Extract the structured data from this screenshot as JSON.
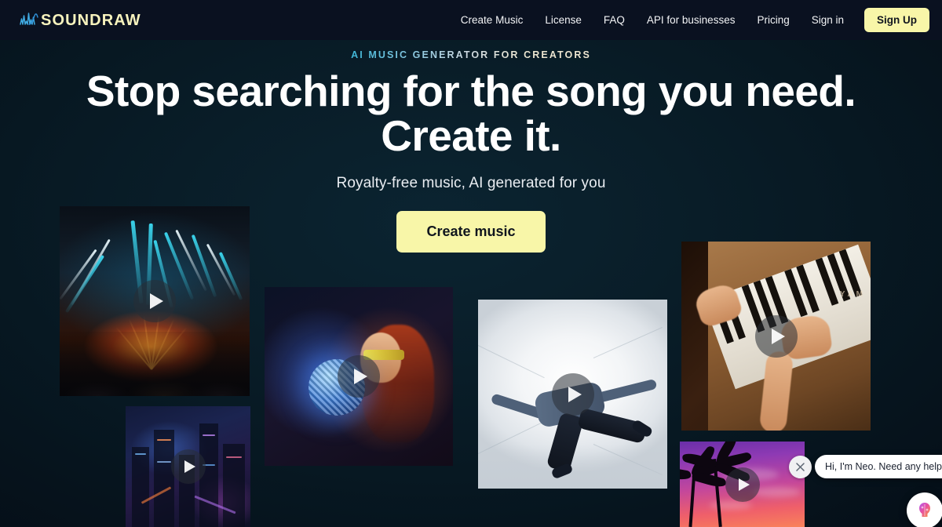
{
  "header": {
    "logo_text": "SOUNDRAW",
    "logo_icon": "waveform-icon",
    "nav": [
      {
        "label": "Create Music"
      },
      {
        "label": "License"
      },
      {
        "label": "FAQ"
      },
      {
        "label": "API for businesses"
      },
      {
        "label": "Pricing"
      },
      {
        "label": "Sign in"
      }
    ],
    "signup_label": "Sign Up"
  },
  "hero": {
    "eyebrow": "AI MUSIC GENERATOR FOR CREATORS",
    "headline_line1": "Stop searching for the song you need.",
    "headline_line2": "Create it.",
    "subtitle": "Royalty-free music, AI generated for you",
    "cta_label": "Create music"
  },
  "cards": [
    {
      "name": "concert-lasers",
      "play_icon": "play-icon"
    },
    {
      "name": "city-night",
      "play_icon": "play-icon"
    },
    {
      "name": "disco-woman",
      "play_icon": "play-icon"
    },
    {
      "name": "breakdancer",
      "play_icon": "play-icon"
    },
    {
      "name": "piano-hands",
      "play_icon": "play-icon"
    },
    {
      "name": "palm-sunset",
      "play_icon": "play-icon"
    }
  ],
  "chat": {
    "message": "Hi, I'm Neo. Need any help?",
    "close_icon": "close-icon",
    "launcher_icon": "chat-brain-icon"
  },
  "colors": {
    "accent_yellow": "#f8f6a8",
    "header_bg": "#0a1120",
    "page_bg": "#081d28",
    "text_primary": "#ffffff",
    "eyebrow_gradient_start": "#3fb8d8",
    "eyebrow_gradient_end": "#f3ead4"
  }
}
